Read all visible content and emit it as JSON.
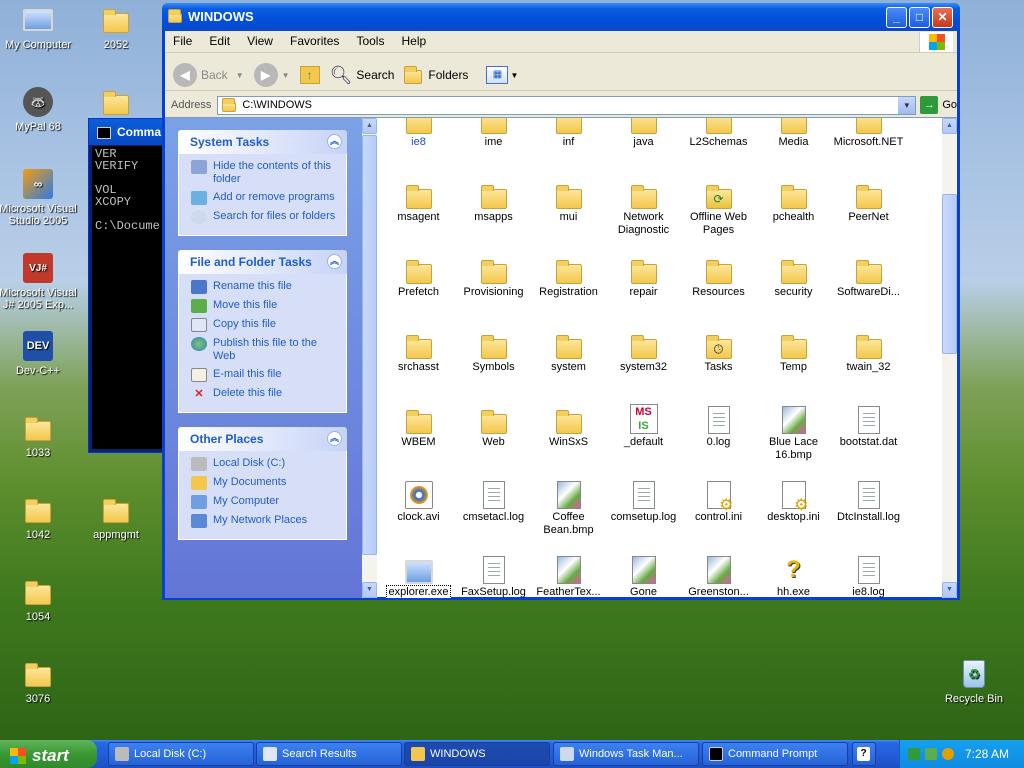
{
  "desktop": {
    "icons": [
      {
        "label": "My Computer"
      },
      {
        "label": "2052"
      },
      {
        "label": "MyPal 68"
      },
      {
        "label": "Microsoft Visual Studio 2005"
      },
      {
        "label": "Microsoft Visual J# 2005 Exp..."
      },
      {
        "label": "Dev-C++"
      },
      {
        "label": "1033"
      },
      {
        "label": "1042"
      },
      {
        "label": "appmgmt"
      },
      {
        "label": "1054"
      },
      {
        "label": "3076"
      },
      {
        "label": "Recycle Bin"
      }
    ]
  },
  "cmd": {
    "title": "Comma",
    "lines": "VER\nVERIFY\n\nVOL\nXCOPY\n\nC:\\Docume"
  },
  "explorer": {
    "title": "WINDOWS",
    "menu": [
      "File",
      "Edit",
      "View",
      "Favorites",
      "Tools",
      "Help"
    ],
    "toolbar": {
      "back": "Back",
      "search": "Search",
      "folders": "Folders"
    },
    "address": {
      "label": "Address",
      "value": "C:\\WINDOWS",
      "go": "Go"
    },
    "system_tasks": {
      "title": "System Tasks",
      "items": [
        "Hide the contents of this folder",
        "Add or remove programs",
        "Search for files or folders"
      ]
    },
    "file_tasks": {
      "title": "File and Folder Tasks",
      "items": [
        "Rename this file",
        "Move this file",
        "Copy this file",
        "Publish this file to the Web",
        "E-mail this file",
        "Delete this file"
      ]
    },
    "other_places": {
      "title": "Other Places",
      "items": [
        "Local Disk (C:)",
        "My Documents",
        "My Computer",
        "My Network Places"
      ]
    },
    "files": [
      [
        "ie8",
        "ime",
        "inf",
        "java",
        "L2Schemas",
        "Media",
        "Microsoft.NET"
      ],
      [
        "msagent",
        "msapps",
        "mui",
        "Network Diagnostic",
        "Offline Web Pages",
        "pchealth",
        "PeerNet"
      ],
      [
        "Prefetch",
        "Provisioning",
        "Registration",
        "repair",
        "Resources",
        "security",
        "SoftwareDi..."
      ],
      [
        "srchasst",
        "Symbols",
        "system",
        "system32",
        "Tasks",
        "Temp",
        "twain_32"
      ],
      [
        "WBEM",
        "Web",
        "WinSxS",
        "_default",
        "0.log",
        "Blue Lace 16.bmp",
        "bootstat.dat"
      ],
      [
        "clock.avi",
        "cmsetacl.log",
        "Coffee Bean.bmp",
        "comsetup.log",
        "control.ini",
        "desktop.ini",
        "DtcInstall.log"
      ],
      [
        "explorer.exe",
        "FaxSetup.log",
        "FeatherTex...",
        "Gone",
        "Greenston...",
        "hh.exe",
        "ie8.log"
      ]
    ]
  },
  "taskbar": {
    "start": "start",
    "tasks": [
      "Local Disk (C:)",
      "Search Results",
      "WINDOWS",
      "Windows Task Man...",
      "Command Prompt"
    ],
    "clock": "7:28 AM"
  }
}
